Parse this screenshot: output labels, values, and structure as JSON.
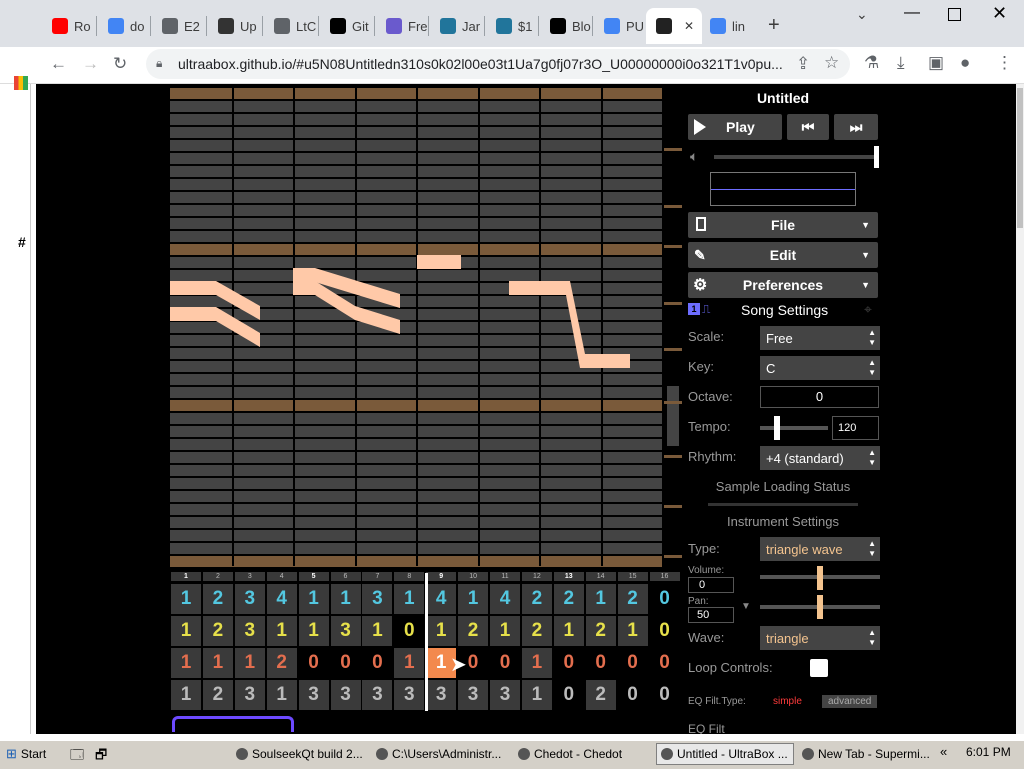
{
  "tabs": [
    {
      "label": "Ro",
      "icon": "youtube-icon",
      "color": "#ff0000"
    },
    {
      "label": "do",
      "icon": "google-icon",
      "color": "#4285f4"
    },
    {
      "label": "E2",
      "icon": "globe-icon",
      "color": "#5f6368"
    },
    {
      "label": "Up",
      "icon": "sb-icon",
      "color": "#333333"
    },
    {
      "label": "LtC",
      "icon": "globe-icon",
      "color": "#5f6368"
    },
    {
      "label": "Git",
      "icon": "github-icon",
      "color": "#000000"
    },
    {
      "label": "Fre",
      "icon": "infinity-icon",
      "color": "#6a5acd"
    },
    {
      "label": "Jar",
      "icon": "wordpress-icon",
      "color": "#21759b"
    },
    {
      "label": "$1",
      "icon": "wordpress-icon",
      "color": "#21759b"
    },
    {
      "label": "Blo",
      "icon": "amazon-icon",
      "color": "#000000"
    },
    {
      "label": "PU",
      "icon": "google-icon",
      "color": "#4285f4"
    },
    {
      "label": "",
      "icon": "ultrabox-icon",
      "color": "#222222"
    },
    {
      "label": "lin",
      "icon": "google-icon",
      "color": "#4285f4"
    }
  ],
  "url": "ultraabox.github.io/#u5N08Untitledn310s0k02l00e03t1Ua7g0fj07r3O_U00000000i0o321T1v0pu...",
  "song_title": "Untitled",
  "buttons": {
    "play": "Play",
    "file": "File",
    "edit": "Edit",
    "preferences": "Preferences"
  },
  "song_settings": {
    "header": "Song Settings",
    "scale_label": "Scale:",
    "scale_value": "Free",
    "key_label": "Key:",
    "key_value": "C",
    "octave_label": "Octave:",
    "octave_value": "0",
    "tempo_label": "Tempo:",
    "tempo_value": "120",
    "rhythm_label": "Rhythm:",
    "rhythm_value": "+4 (standard)"
  },
  "sample_status": "Sample Loading Status",
  "instrument": {
    "header": "Instrument Settings",
    "type_label": "Type:",
    "type_value": "triangle wave",
    "volume_label": "Volume:",
    "volume_value": "0",
    "pan_label": "Pan:",
    "pan_value": "50",
    "wave_label": "Wave:",
    "wave_value": "triangle",
    "loop_label": "Loop Controls:",
    "eq_label": "EQ Filt.Type:",
    "eq_simple": "simple",
    "eq_advanced": "advanced",
    "eq_partial": "EQ Filt"
  },
  "bar_numbers": [
    "1",
    "2",
    "3",
    "4",
    "5",
    "6",
    "7",
    "8",
    "9",
    "10",
    "11",
    "12",
    "13",
    "14",
    "15",
    "16"
  ],
  "track_rows": [
    {
      "color": "#53c7e0",
      "cells": [
        "1",
        "2",
        "3",
        "4",
        "1",
        "1",
        "3",
        "1",
        "4",
        "1",
        "4",
        "2",
        "2",
        "1",
        "2",
        "0"
      ]
    },
    {
      "color": "#e6e04a",
      "cells": [
        "1",
        "2",
        "3",
        "1",
        "1",
        "3",
        "1",
        "0",
        "1",
        "2",
        "1",
        "2",
        "1",
        "2",
        "1",
        "0"
      ]
    },
    {
      "color": "#e36e4e",
      "cells": [
        "1",
        "1",
        "1",
        "2",
        "0",
        "0",
        "0",
        "1",
        "1",
        "0",
        "0",
        "1",
        "0",
        "0",
        "0",
        "0"
      ]
    },
    {
      "color": "#bbbbbb",
      "cells": [
        "1",
        "2",
        "3",
        "1",
        "3",
        "3",
        "3",
        "3",
        "3",
        "3",
        "3",
        "1",
        "0",
        "2",
        "0",
        "0"
      ]
    }
  ],
  "taskbar": {
    "start": "Start",
    "items": [
      "SoulseekQt build 2...",
      "C:\\Users\\Administr...",
      "Chedot - Chedot",
      "Untitled - UltraBox ...",
      "New Tab - Supermi..."
    ],
    "time": "6:01 PM"
  }
}
